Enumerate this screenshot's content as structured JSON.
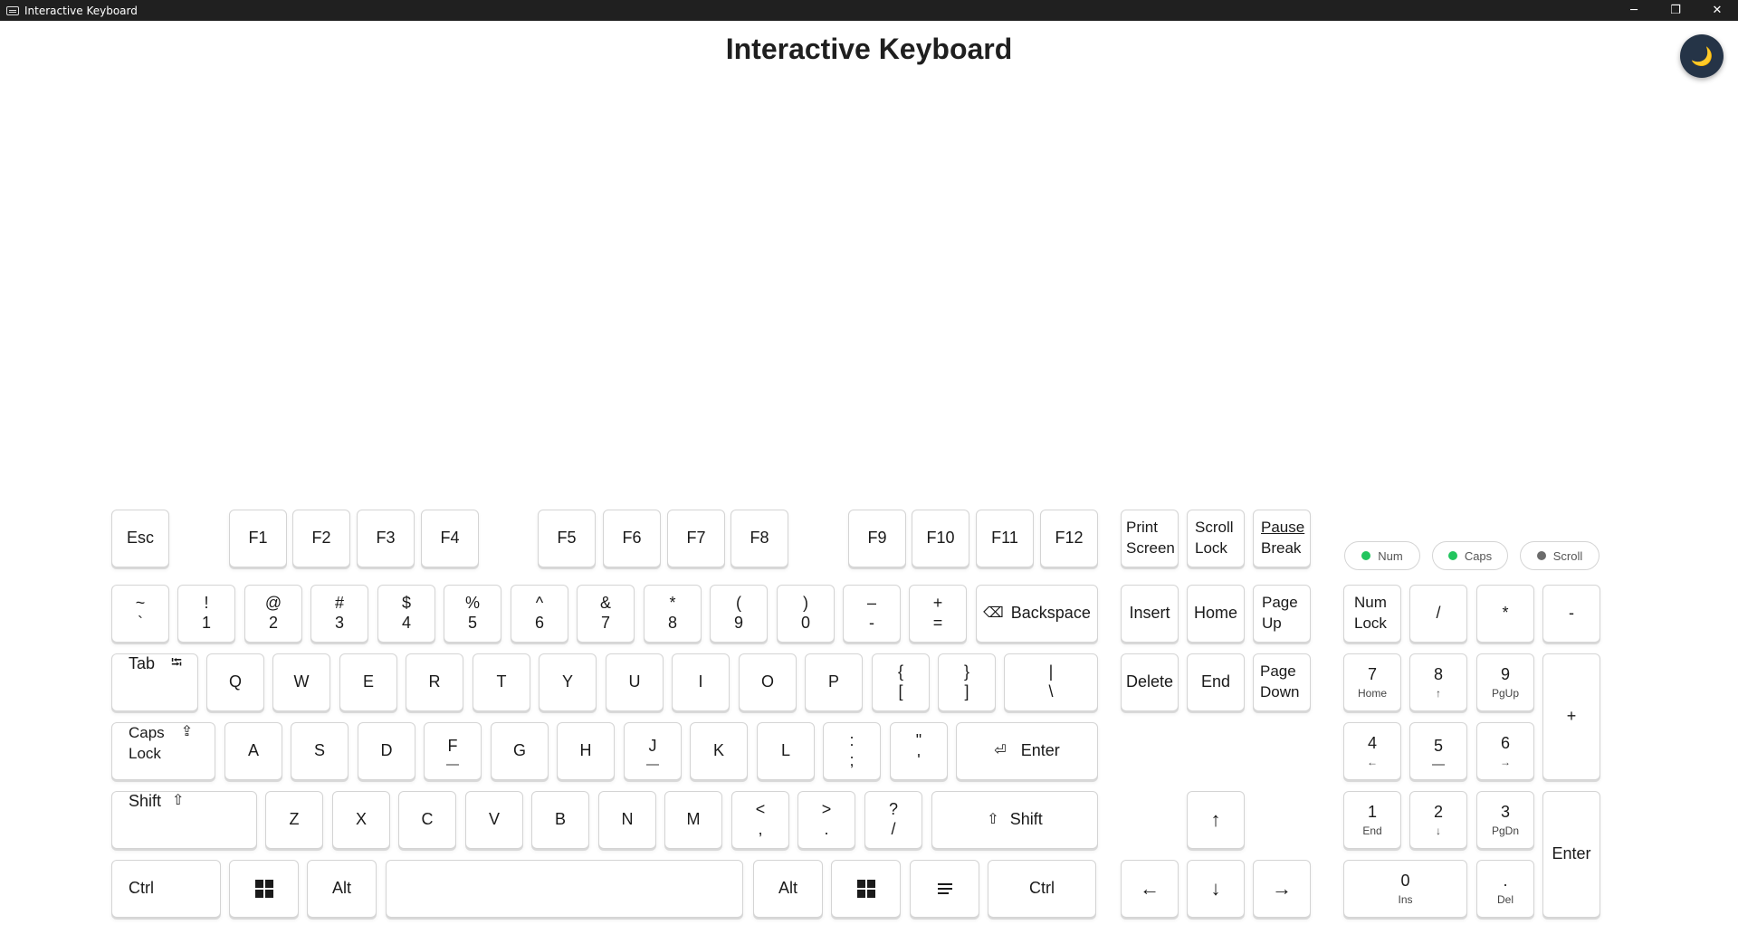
{
  "window": {
    "title": "Interactive Keyboard",
    "minimize": "─",
    "restore": "❐",
    "close": "✕"
  },
  "page": {
    "title": "Interactive Keyboard",
    "theme_icon": "🌙"
  },
  "keys": {
    "esc": "Esc",
    "f1": "F1",
    "f2": "F2",
    "f3": "F3",
    "f4": "F4",
    "f5": "F5",
    "f6": "F6",
    "f7": "F7",
    "f8": "F8",
    "f9": "F9",
    "f10": "F10",
    "f11": "F11",
    "f12": "F12",
    "print_screen": [
      "Print",
      "Screen"
    ],
    "scroll_lock": [
      "Scroll",
      "Lock"
    ],
    "pause_break": [
      "Pause",
      "Break"
    ],
    "backtick": [
      "~",
      "`"
    ],
    "d1": [
      "!",
      "1"
    ],
    "d2": [
      "@",
      "2"
    ],
    "d3": [
      "#",
      "3"
    ],
    "d4": [
      "$",
      "4"
    ],
    "d5": [
      "%",
      "5"
    ],
    "d6": [
      "^",
      "6"
    ],
    "d7": [
      "&",
      "7"
    ],
    "d8": [
      "*",
      "8"
    ],
    "d9": [
      "(",
      "9"
    ],
    "d0": [
      ")",
      "0"
    ],
    "minus": [
      "–",
      "-"
    ],
    "equal": [
      "+",
      "="
    ],
    "backspace": {
      "label": "Backspace",
      "icon": "⌫"
    },
    "insert": "Insert",
    "home": "Home",
    "page_up": [
      "Page",
      "Up"
    ],
    "tab": {
      "label": "Tab",
      "icon": "⭾"
    },
    "q": "Q",
    "w": "W",
    "e": "E",
    "r": "R",
    "t": "T",
    "y": "Y",
    "u": "U",
    "i": "I",
    "o": "O",
    "p": "P",
    "lbracket": [
      "{",
      "["
    ],
    "rbracket": [
      "}",
      "]"
    ],
    "backslash": [
      "|",
      "\\"
    ],
    "delete": "Delete",
    "end": "End",
    "page_down": [
      "Page",
      "Down"
    ],
    "caps_lock": {
      "label": [
        "Caps",
        "Lock"
      ],
      "icon": "⇪"
    },
    "a": "A",
    "s": "S",
    "d": "D",
    "f": "F",
    "g": "G",
    "h": "H",
    "j": "J",
    "k": "K",
    "l": "L",
    "semicolon": [
      ":",
      ";"
    ],
    "quote": [
      "\"",
      "'"
    ],
    "enter": {
      "label": "Enter",
      "icon": "⏎"
    },
    "lshift": {
      "label": "Shift",
      "icon": "⇧"
    },
    "z": "Z",
    "x": "X",
    "c": "C",
    "v": "V",
    "b": "B",
    "n": "N",
    "m": "M",
    "comma": [
      "<",
      ","
    ],
    "period": [
      ">",
      "."
    ],
    "slash": [
      "?",
      "/"
    ],
    "rshift": {
      "label": "Shift",
      "icon": "⇧"
    },
    "lctrl": "Ctrl",
    "lalt": "Alt",
    "ralt": "Alt",
    "rctrl": "Ctrl",
    "arrow_up": "↑",
    "arrow_left": "←",
    "arrow_down": "↓",
    "arrow_right": "→"
  },
  "numpad": {
    "num_lock": [
      "Num",
      "Lock"
    ],
    "divide": "/",
    "multiply": "*",
    "subtract": "-",
    "n7": [
      "7",
      "Home"
    ],
    "n8": [
      "8",
      "↑"
    ],
    "n9": [
      "9",
      "PgUp"
    ],
    "add": "+",
    "n4": [
      "4",
      "←"
    ],
    "n5": "5",
    "n6": [
      "6",
      "→"
    ],
    "n1": [
      "1",
      "End"
    ],
    "n2": [
      "2",
      "↓"
    ],
    "n3": [
      "3",
      "PgDn"
    ],
    "enter": "Enter",
    "n0": [
      "0",
      "Ins"
    ],
    "decimal": [
      ".",
      "Del"
    ]
  },
  "indicators": [
    {
      "label": "Num",
      "color": "#22c55e"
    },
    {
      "label": "Caps",
      "color": "#22c55e"
    },
    {
      "label": "Scroll",
      "color": "#6b6b6b"
    }
  ]
}
